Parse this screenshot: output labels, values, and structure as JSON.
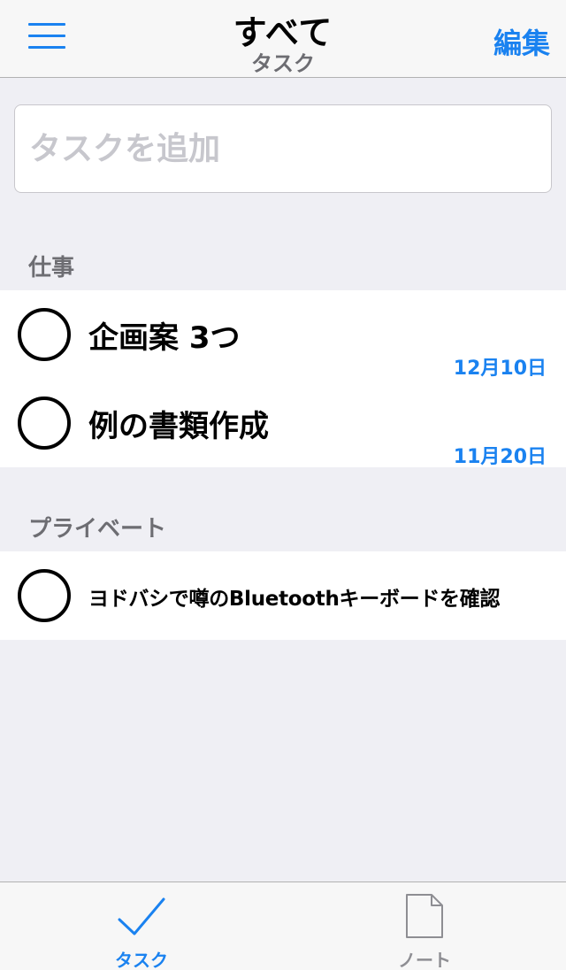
{
  "nav": {
    "title": "すべて",
    "subtitle": "タスク",
    "edit_label": "編集",
    "menu_icon": "hamburger-icon"
  },
  "add_task": {
    "placeholder": "タスクを追加",
    "value": ""
  },
  "sections": [
    {
      "header": "仕事",
      "tasks": [
        {
          "title": "企画案 3つ",
          "date": "12月10日",
          "completed": false
        },
        {
          "title": "例の書類作成",
          "date": "11月20日",
          "completed": false
        }
      ]
    },
    {
      "header": "プライベート",
      "tasks": [
        {
          "title": "ヨドバシで噂のBluetoothキーボードを確認",
          "date": "",
          "completed": false
        }
      ]
    }
  ],
  "tabbar": {
    "tabs": [
      {
        "label": "タスク",
        "icon": "checkmark-icon",
        "selected": true
      },
      {
        "label": "ノート",
        "icon": "document-icon",
        "selected": false
      }
    ]
  },
  "colors": {
    "accent": "#1a82f0",
    "background": "#efeff4",
    "secondary_text": "#6d6d72"
  }
}
